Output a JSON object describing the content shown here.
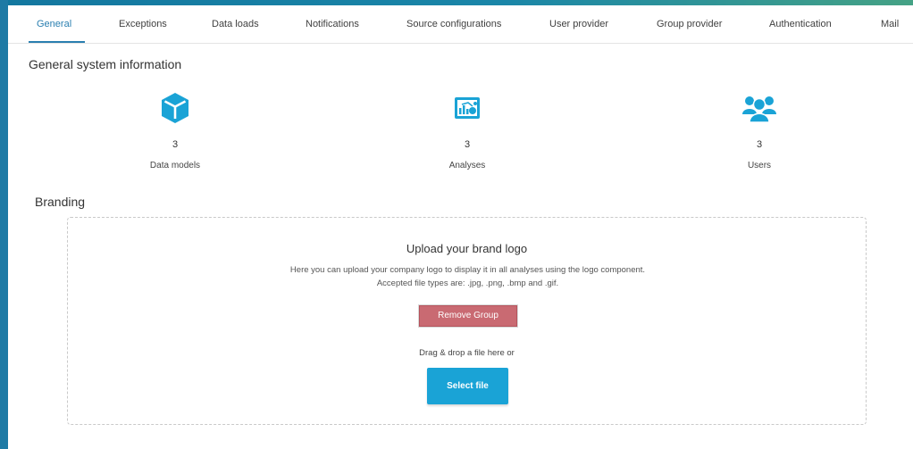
{
  "colors": {
    "accent": "#2a7fb0",
    "icon": "#1aa3d6",
    "danger_button": "#c96a72",
    "primary_button": "#1aa3d6",
    "left_bar": "#1e7aa5"
  },
  "tabs": [
    {
      "label": "General",
      "active": true
    },
    {
      "label": "Exceptions",
      "active": false
    },
    {
      "label": "Data loads",
      "active": false
    },
    {
      "label": "Notifications",
      "active": false
    },
    {
      "label": "Source configurations",
      "active": false
    },
    {
      "label": "User provider",
      "active": false
    },
    {
      "label": "Group provider",
      "active": false
    },
    {
      "label": "Authentication",
      "active": false
    },
    {
      "label": "Mail",
      "active": false
    }
  ],
  "general": {
    "title": "General system information",
    "stats": [
      {
        "icon": "cube-icon",
        "value": "3",
        "label": "Data models"
      },
      {
        "icon": "analysis-chart-icon",
        "value": "3",
        "label": "Analyses"
      },
      {
        "icon": "users-group-icon",
        "value": "3",
        "label": "Users"
      }
    ]
  },
  "branding": {
    "title": "Branding",
    "upload_title": "Upload your brand logo",
    "upload_description": "Here you can upload your company logo to display it in all analyses using the logo component. Accepted file types are: .jpg, .png, .bmp and .gif.",
    "remove_button": "Remove Group",
    "drag_text": "Drag & drop a file here or",
    "select_button": "Select file"
  }
}
